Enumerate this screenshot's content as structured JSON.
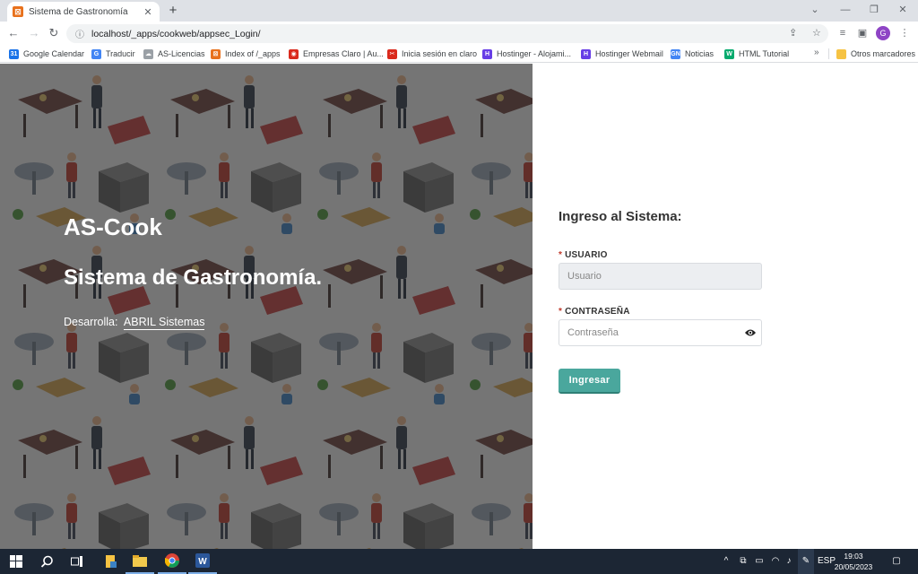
{
  "browser": {
    "tab": {
      "title": "Sistema de Gastronomía",
      "close": "✕"
    },
    "new_tab": "+",
    "address": {
      "url": "localhost/_apps/cookweb/appsec_Login/"
    },
    "profile_initial": "G"
  },
  "bookmarks": {
    "items": [
      {
        "label": "Google Calendar",
        "color": "#1a73e8",
        "glyph": "31"
      },
      {
        "label": "Traducir",
        "color": "#4285f4",
        "glyph": "G"
      },
      {
        "label": "AS-Licencias",
        "color": "#9aa0a6",
        "glyph": "☁"
      },
      {
        "label": "Index of /_apps",
        "color": "#e8711c",
        "glyph": "⊠"
      },
      {
        "label": "Empresas Claro | Au...",
        "color": "#da291c",
        "glyph": "◉"
      },
      {
        "label": "Inicia sesión en claro",
        "color": "#da291c",
        "glyph": "✂"
      },
      {
        "label": "Hostinger - Alojami...",
        "color": "#673de6",
        "glyph": "H"
      },
      {
        "label": "Hostinger Webmail",
        "color": "#673de6",
        "glyph": "H"
      },
      {
        "label": "Noticias",
        "color": "#4285f4",
        "glyph": "GN"
      },
      {
        "label": "HTML Tutorial",
        "color": "#04aa6d",
        "glyph": "W"
      }
    ],
    "more": "»",
    "other_folder": "Otros marcadores"
  },
  "hero": {
    "brand": "AS-Cook",
    "title": "Sistema de Gastronomía.",
    "developed_by_label": "Desarrolla:",
    "developer_link": "ABRIL Sistemas"
  },
  "login": {
    "heading": "Ingreso al Sistema:",
    "required_mark": "*",
    "user_label": "USUARIO",
    "user_placeholder": "Usuario",
    "password_label": "CONTRASEÑA",
    "password_placeholder": "Contraseña",
    "submit_label": "Ingresar"
  },
  "taskbar": {
    "language": "ESP",
    "time": "19:03",
    "date": "20/05/2023"
  },
  "colors": {
    "accent": "#4aa79d",
    "overlay": "#282828",
    "taskbar": "#1c2634"
  }
}
